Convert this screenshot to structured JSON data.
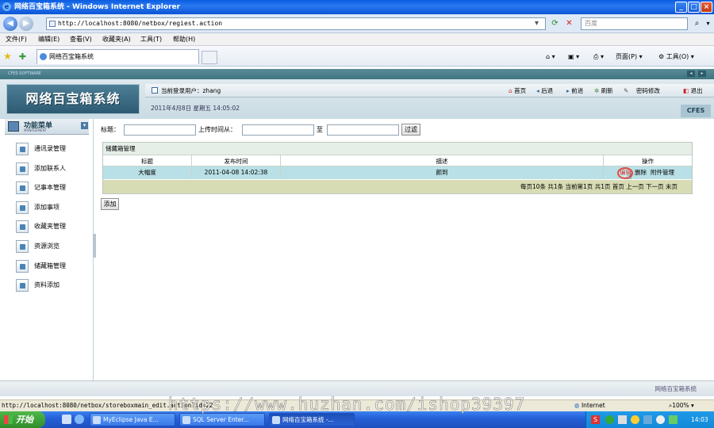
{
  "window": {
    "title": "网络百宝箱系统 - Windows Internet Explorer"
  },
  "browser": {
    "address": "http://localhost:8080/netbox/regiest.action",
    "search_placeholder": "百度",
    "menu": [
      "文件(F)",
      "编辑(E)",
      "查看(V)",
      "收藏夹(A)",
      "工具(T)",
      "帮助(H)"
    ],
    "tab_title": "网络百宝箱系统",
    "tools": {
      "page": "页面(P)",
      "tools": "工具(O)"
    },
    "status_url": "http://localhost:8080/netbox/storeboxmain_edit.action?id=22",
    "zone": "Internet",
    "zoom": "100%"
  },
  "app": {
    "logo": "网络百宝箱系统",
    "strip": "CFES SOFTWARE",
    "current_user": "当前登录用户：zhang",
    "date": "2011年4月8日 星期五 14:05:02",
    "brand": "CFES",
    "top_links": [
      "首页",
      "后退",
      "前进",
      "刷新",
      "密码修改",
      "退出"
    ],
    "menu_title": "功能菜单",
    "menu_subtitle": "MANAGEMENT",
    "sidebar": [
      "通讯录管理",
      "添加联系人",
      "记事本管理",
      "添加事项",
      "收藏夹管理",
      "资源浏览",
      "储藏箱管理",
      "资料添加"
    ],
    "footer": "网络百宝箱系统"
  },
  "filter": {
    "title_label": "标题：",
    "upload_from_label": "上传时间从：",
    "to_label": "至",
    "filter_button": "过滤"
  },
  "grid": {
    "caption": "储藏箱管理",
    "columns": [
      "标题",
      "发布时间",
      "描述",
      "操作"
    ],
    "rows": [
      {
        "title": "大幅度",
        "time": "2011-04-08 14:02:38",
        "desc": "颜到",
        "ops": [
          "编辑",
          "删除",
          "附件管理"
        ]
      }
    ],
    "pager": "每页10条 共1条 当前第1页 共1页 首页 上一页 下一页 末页"
  },
  "add_button": "添加",
  "taskbar": {
    "start": "开始",
    "tasks": [
      "MyEclipse Java E...",
      "SQL Server Enter...",
      "网络百宝箱系统 -..."
    ],
    "clock": "14:03"
  },
  "watermark": "https://www.huzhan.com/ishop39397"
}
